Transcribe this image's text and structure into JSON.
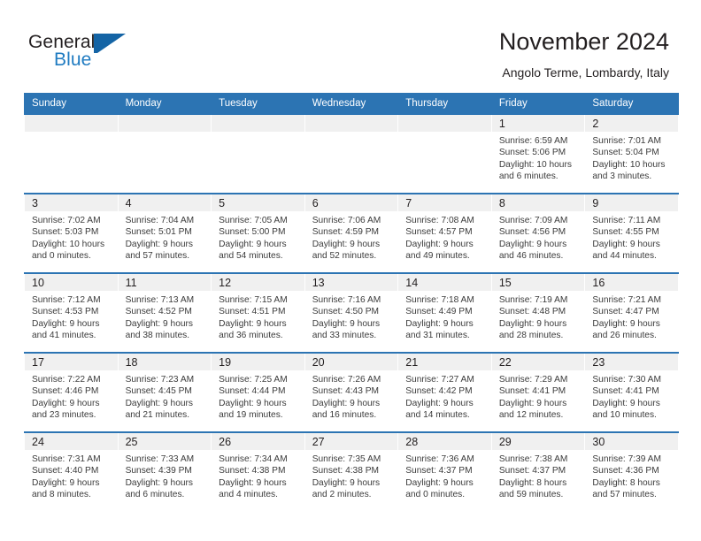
{
  "brand": {
    "name_part1": "General",
    "name_part2": "Blue",
    "accent_color": "#1f7bc1",
    "mark_color": "#1464a5",
    "logo_icon": "flag-triangle-icon"
  },
  "header": {
    "title": "November 2024",
    "subtitle": "Angolo Terme, Lombardy, Italy"
  },
  "theme": {
    "header_bg": "#2c74b3",
    "daynum_bg": "#f0f0f0",
    "text_color": "#231f20"
  },
  "weekdays": [
    "Sunday",
    "Monday",
    "Tuesday",
    "Wednesday",
    "Thursday",
    "Friday",
    "Saturday"
  ],
  "weeks": [
    [
      {
        "day": "",
        "sunrise": "",
        "sunset": "",
        "daylight1": "",
        "daylight2": ""
      },
      {
        "day": "",
        "sunrise": "",
        "sunset": "",
        "daylight1": "",
        "daylight2": ""
      },
      {
        "day": "",
        "sunrise": "",
        "sunset": "",
        "daylight1": "",
        "daylight2": ""
      },
      {
        "day": "",
        "sunrise": "",
        "sunset": "",
        "daylight1": "",
        "daylight2": ""
      },
      {
        "day": "",
        "sunrise": "",
        "sunset": "",
        "daylight1": "",
        "daylight2": ""
      },
      {
        "day": "1",
        "sunrise": "Sunrise: 6:59 AM",
        "sunset": "Sunset: 5:06 PM",
        "daylight1": "Daylight: 10 hours",
        "daylight2": "and 6 minutes."
      },
      {
        "day": "2",
        "sunrise": "Sunrise: 7:01 AM",
        "sunset": "Sunset: 5:04 PM",
        "daylight1": "Daylight: 10 hours",
        "daylight2": "and 3 minutes."
      }
    ],
    [
      {
        "day": "3",
        "sunrise": "Sunrise: 7:02 AM",
        "sunset": "Sunset: 5:03 PM",
        "daylight1": "Daylight: 10 hours",
        "daylight2": "and 0 minutes."
      },
      {
        "day": "4",
        "sunrise": "Sunrise: 7:04 AM",
        "sunset": "Sunset: 5:01 PM",
        "daylight1": "Daylight: 9 hours",
        "daylight2": "and 57 minutes."
      },
      {
        "day": "5",
        "sunrise": "Sunrise: 7:05 AM",
        "sunset": "Sunset: 5:00 PM",
        "daylight1": "Daylight: 9 hours",
        "daylight2": "and 54 minutes."
      },
      {
        "day": "6",
        "sunrise": "Sunrise: 7:06 AM",
        "sunset": "Sunset: 4:59 PM",
        "daylight1": "Daylight: 9 hours",
        "daylight2": "and 52 minutes."
      },
      {
        "day": "7",
        "sunrise": "Sunrise: 7:08 AM",
        "sunset": "Sunset: 4:57 PM",
        "daylight1": "Daylight: 9 hours",
        "daylight2": "and 49 minutes."
      },
      {
        "day": "8",
        "sunrise": "Sunrise: 7:09 AM",
        "sunset": "Sunset: 4:56 PM",
        "daylight1": "Daylight: 9 hours",
        "daylight2": "and 46 minutes."
      },
      {
        "day": "9",
        "sunrise": "Sunrise: 7:11 AM",
        "sunset": "Sunset: 4:55 PM",
        "daylight1": "Daylight: 9 hours",
        "daylight2": "and 44 minutes."
      }
    ],
    [
      {
        "day": "10",
        "sunrise": "Sunrise: 7:12 AM",
        "sunset": "Sunset: 4:53 PM",
        "daylight1": "Daylight: 9 hours",
        "daylight2": "and 41 minutes."
      },
      {
        "day": "11",
        "sunrise": "Sunrise: 7:13 AM",
        "sunset": "Sunset: 4:52 PM",
        "daylight1": "Daylight: 9 hours",
        "daylight2": "and 38 minutes."
      },
      {
        "day": "12",
        "sunrise": "Sunrise: 7:15 AM",
        "sunset": "Sunset: 4:51 PM",
        "daylight1": "Daylight: 9 hours",
        "daylight2": "and 36 minutes."
      },
      {
        "day": "13",
        "sunrise": "Sunrise: 7:16 AM",
        "sunset": "Sunset: 4:50 PM",
        "daylight1": "Daylight: 9 hours",
        "daylight2": "and 33 minutes."
      },
      {
        "day": "14",
        "sunrise": "Sunrise: 7:18 AM",
        "sunset": "Sunset: 4:49 PM",
        "daylight1": "Daylight: 9 hours",
        "daylight2": "and 31 minutes."
      },
      {
        "day": "15",
        "sunrise": "Sunrise: 7:19 AM",
        "sunset": "Sunset: 4:48 PM",
        "daylight1": "Daylight: 9 hours",
        "daylight2": "and 28 minutes."
      },
      {
        "day": "16",
        "sunrise": "Sunrise: 7:21 AM",
        "sunset": "Sunset: 4:47 PM",
        "daylight1": "Daylight: 9 hours",
        "daylight2": "and 26 minutes."
      }
    ],
    [
      {
        "day": "17",
        "sunrise": "Sunrise: 7:22 AM",
        "sunset": "Sunset: 4:46 PM",
        "daylight1": "Daylight: 9 hours",
        "daylight2": "and 23 minutes."
      },
      {
        "day": "18",
        "sunrise": "Sunrise: 7:23 AM",
        "sunset": "Sunset: 4:45 PM",
        "daylight1": "Daylight: 9 hours",
        "daylight2": "and 21 minutes."
      },
      {
        "day": "19",
        "sunrise": "Sunrise: 7:25 AM",
        "sunset": "Sunset: 4:44 PM",
        "daylight1": "Daylight: 9 hours",
        "daylight2": "and 19 minutes."
      },
      {
        "day": "20",
        "sunrise": "Sunrise: 7:26 AM",
        "sunset": "Sunset: 4:43 PM",
        "daylight1": "Daylight: 9 hours",
        "daylight2": "and 16 minutes."
      },
      {
        "day": "21",
        "sunrise": "Sunrise: 7:27 AM",
        "sunset": "Sunset: 4:42 PM",
        "daylight1": "Daylight: 9 hours",
        "daylight2": "and 14 minutes."
      },
      {
        "day": "22",
        "sunrise": "Sunrise: 7:29 AM",
        "sunset": "Sunset: 4:41 PM",
        "daylight1": "Daylight: 9 hours",
        "daylight2": "and 12 minutes."
      },
      {
        "day": "23",
        "sunrise": "Sunrise: 7:30 AM",
        "sunset": "Sunset: 4:41 PM",
        "daylight1": "Daylight: 9 hours",
        "daylight2": "and 10 minutes."
      }
    ],
    [
      {
        "day": "24",
        "sunrise": "Sunrise: 7:31 AM",
        "sunset": "Sunset: 4:40 PM",
        "daylight1": "Daylight: 9 hours",
        "daylight2": "and 8 minutes."
      },
      {
        "day": "25",
        "sunrise": "Sunrise: 7:33 AM",
        "sunset": "Sunset: 4:39 PM",
        "daylight1": "Daylight: 9 hours",
        "daylight2": "and 6 minutes."
      },
      {
        "day": "26",
        "sunrise": "Sunrise: 7:34 AM",
        "sunset": "Sunset: 4:38 PM",
        "daylight1": "Daylight: 9 hours",
        "daylight2": "and 4 minutes."
      },
      {
        "day": "27",
        "sunrise": "Sunrise: 7:35 AM",
        "sunset": "Sunset: 4:38 PM",
        "daylight1": "Daylight: 9 hours",
        "daylight2": "and 2 minutes."
      },
      {
        "day": "28",
        "sunrise": "Sunrise: 7:36 AM",
        "sunset": "Sunset: 4:37 PM",
        "daylight1": "Daylight: 9 hours",
        "daylight2": "and 0 minutes."
      },
      {
        "day": "29",
        "sunrise": "Sunrise: 7:38 AM",
        "sunset": "Sunset: 4:37 PM",
        "daylight1": "Daylight: 8 hours",
        "daylight2": "and 59 minutes."
      },
      {
        "day": "30",
        "sunrise": "Sunrise: 7:39 AM",
        "sunset": "Sunset: 4:36 PM",
        "daylight1": "Daylight: 8 hours",
        "daylight2": "and 57 minutes."
      }
    ]
  ]
}
